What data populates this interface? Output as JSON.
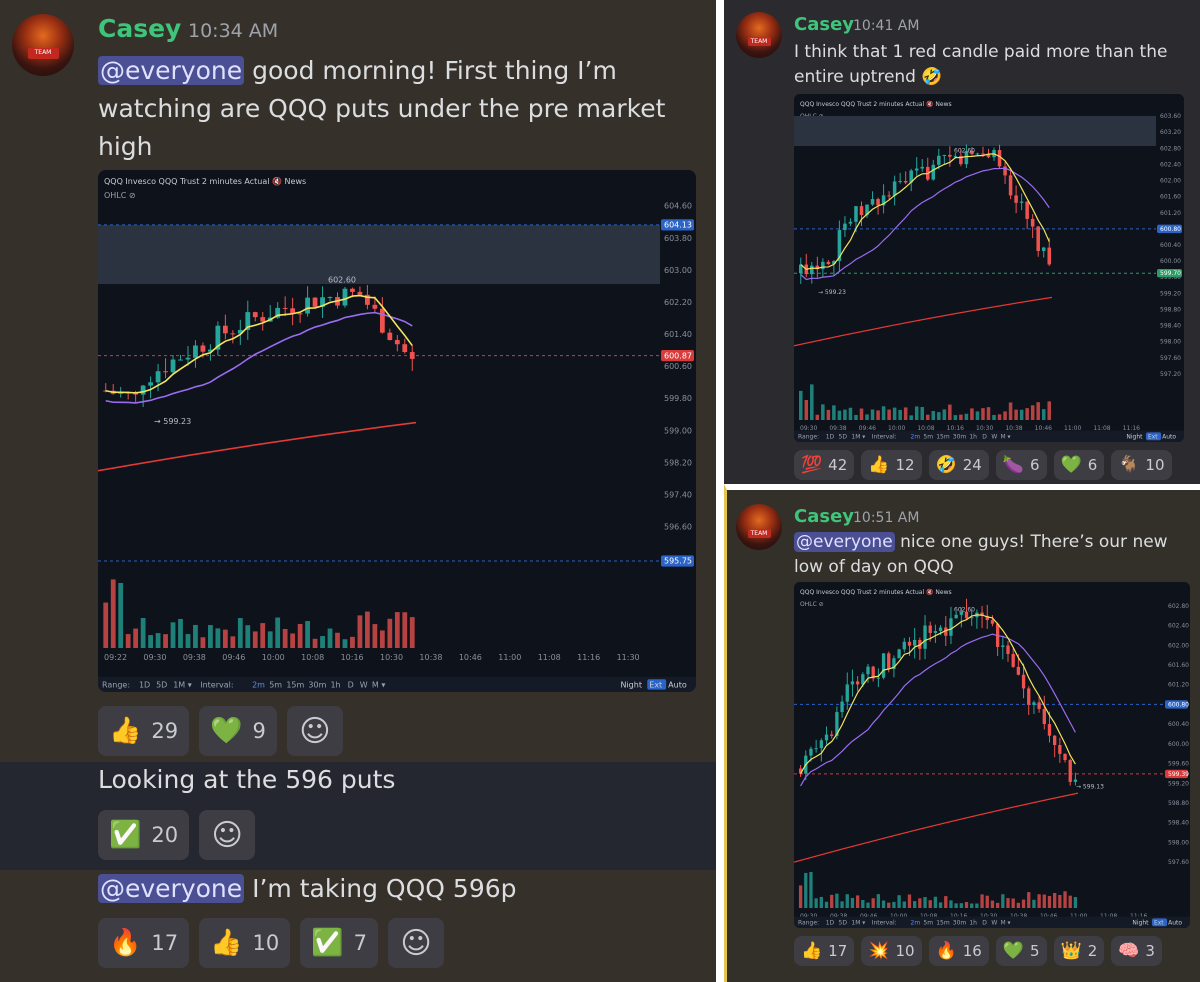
{
  "author": {
    "name": "Casey"
  },
  "messages": [
    {
      "time": "10:34 AM",
      "mention": "@everyone",
      "text": " good morning! First thing I’m watching are QQQ puts under the pre market high"
    },
    {
      "text": "Looking at the 596 puts"
    },
    {
      "mention": "@everyone",
      "text": " I’m taking QQQ 596p"
    },
    {
      "time": "10:41 AM",
      "text": "I think that 1 red candle paid more than the entire uptrend 🤣"
    },
    {
      "time": "10:51 AM",
      "mention": "@everyone",
      "text": " nice one guys! There’s our new low of day on QQQ"
    }
  ],
  "reactions": {
    "r1": [
      {
        "emoji": "👍",
        "count": "29"
      },
      {
        "emoji": "💚",
        "count": "9"
      },
      {
        "emoji": "☺",
        "count": ""
      }
    ],
    "r2": [
      {
        "emoji": "✅",
        "count": "20"
      },
      {
        "emoji": "☺",
        "count": ""
      }
    ],
    "r3": [
      {
        "emoji": "🔥",
        "count": "17"
      },
      {
        "emoji": "👍",
        "count": "10"
      },
      {
        "emoji": "✅",
        "count": "7"
      },
      {
        "emoji": "☺",
        "count": ""
      }
    ],
    "r4": [
      {
        "emoji": "💯",
        "count": "42"
      },
      {
        "emoji": "👍",
        "count": "12"
      },
      {
        "emoji": "🤣",
        "count": "24"
      },
      {
        "emoji": "🍆",
        "count": "6"
      },
      {
        "emoji": "💚",
        "count": "6"
      },
      {
        "emoji": "🐐",
        "count": "10"
      }
    ],
    "r5": [
      {
        "emoji": "👍",
        "count": "17"
      },
      {
        "emoji": "💥",
        "count": "10"
      },
      {
        "emoji": "🔥",
        "count": "16"
      },
      {
        "emoji": "💚",
        "count": "5"
      },
      {
        "emoji": "👑",
        "count": "2"
      },
      {
        "emoji": "🧠",
        "count": "3"
      }
    ]
  },
  "avatar_badge": "TEAM",
  "chart_data": [
    {
      "type": "candlestick",
      "header": "QQQ  Invesco QQQ Trust  2 minutes  Actual  🔇 News",
      "indicator_label": "OHLC",
      "yticks": [
        "604.60",
        "603.80",
        "603.00",
        "602.20",
        "601.40",
        "600.60",
        "599.80",
        "599.00",
        "598.20",
        "597.40",
        "596.60"
      ],
      "ylim": [
        595.4,
        605.0
      ],
      "xticks": [
        "09:22",
        "09:30",
        "09:38",
        "09:46",
        "10:00",
        "10:08",
        "10:16",
        "10:30",
        "10:38",
        "10:46",
        "11:00",
        "11:08",
        "11:16",
        "11:30"
      ],
      "price_tags": [
        {
          "value": 604.13,
          "label": "604.13",
          "color": "#2b63c7"
        },
        {
          "value": 600.87,
          "label": "600.87",
          "color": "#d93a3a"
        },
        {
          "value": 595.75,
          "label": "595.75",
          "color": "#2b63c7"
        }
      ],
      "annotations": [
        {
          "label": "602.60"
        },
        {
          "label": "599.23"
        }
      ],
      "bottom_bar": [
        "Range:",
        "1D",
        "5D",
        "1M ▾",
        "Interval:",
        "2m",
        "5m",
        "15m",
        "30m",
        "1h",
        "D",
        "W",
        "M ▾"
      ],
      "bottom_right": [
        "Night",
        "Ext",
        "Auto"
      ]
    },
    {
      "type": "candlestick",
      "header": "QQQ  Invesco QQQ Trust  2 minutes  Actual  🔇 News",
      "indicator_label": "OHLC",
      "yticks": [
        "603.60",
        "603.20",
        "602.80",
        "602.40",
        "602.00",
        "601.60",
        "601.20",
        "600.80",
        "600.40",
        "600.00",
        "599.60",
        "599.20",
        "598.80",
        "598.40",
        "598.00",
        "597.60",
        "597.20"
      ],
      "ylim": [
        597.0,
        603.8
      ],
      "xticks": [
        "09:30",
        "09:38",
        "09:46",
        "10:00",
        "10:08",
        "10:16",
        "10:30",
        "10:38",
        "10:46",
        "11:00",
        "11:08",
        "11:16"
      ],
      "price_tags": [
        {
          "value": 600.8,
          "label": "600.80",
          "color": "#2b63c7"
        },
        {
          "value": 599.7,
          "label": "599.70",
          "color": "#2a9d64"
        }
      ],
      "annotations": [
        {
          "label": "602.60"
        },
        {
          "label": "599.23"
        }
      ],
      "bottom_bar": [
        "Range:",
        "1D",
        "5D",
        "1M ▾",
        "Interval:",
        "2m",
        "5m",
        "15m",
        "30m",
        "1h",
        "D",
        "W",
        "M ▾"
      ],
      "bottom_right": [
        "Night",
        "Ext",
        "Auto"
      ]
    },
    {
      "type": "candlestick",
      "header": "QQQ  Invesco QQQ Trust  2 minutes  Actual  🔇 News",
      "indicator_label": "OHLC",
      "yticks": [
        "602.80",
        "602.40",
        "602.00",
        "601.60",
        "601.20",
        "600.80",
        "600.40",
        "600.00",
        "599.60",
        "599.20",
        "598.80",
        "598.40",
        "598.00",
        "597.60"
      ],
      "ylim": [
        597.4,
        603.0
      ],
      "xticks": [
        "09:30",
        "09:38",
        "09:46",
        "10:00",
        "10:08",
        "10:16",
        "10:30",
        "10:38",
        "10:46",
        "11:00",
        "11:08",
        "11:16"
      ],
      "price_tags": [
        {
          "value": 600.8,
          "label": "600.80",
          "color": "#2b63c7"
        },
        {
          "value": 599.39,
          "label": "599.39",
          "color": "#d93a3a"
        }
      ],
      "annotations": [
        {
          "label": "602.60"
        },
        {
          "label": "599.13"
        }
      ],
      "bottom_bar": [
        "Range:",
        "1D",
        "5D",
        "1M ▾",
        "Interval:",
        "2m",
        "5m",
        "15m",
        "30m",
        "1h",
        "D",
        "W",
        "M ▾"
      ],
      "bottom_right": [
        "Night",
        "Ext",
        "Auto"
      ]
    }
  ]
}
